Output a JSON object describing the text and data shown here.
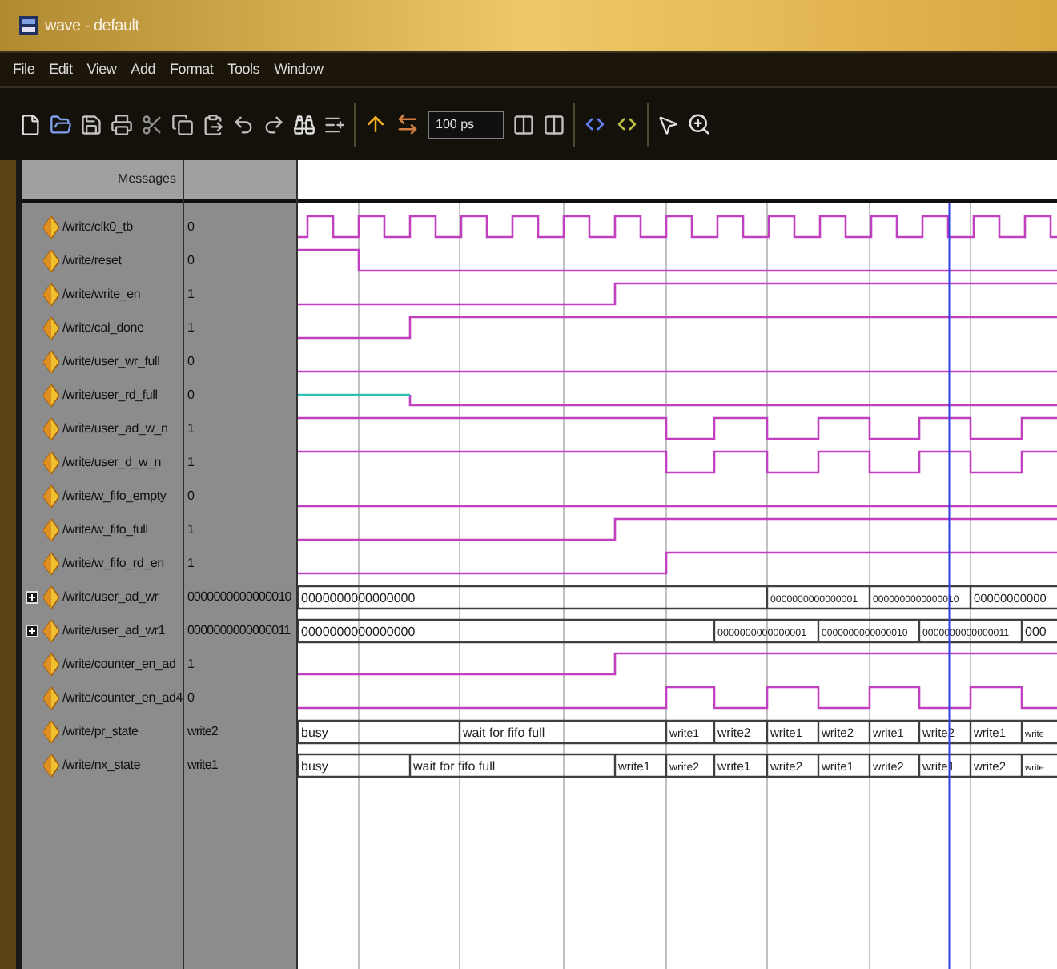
{
  "window": {
    "title": "wave - default"
  },
  "menu": [
    "File",
    "Edit",
    "View",
    "Add",
    "Format",
    "Tools",
    "Window"
  ],
  "toolbar": {
    "time_field": "100 ps"
  },
  "panel": {
    "header": "Messages"
  },
  "signals": [
    {
      "name": "/write/clk0_tb",
      "value": "0",
      "kind": "bit"
    },
    {
      "name": "/write/reset",
      "value": "0",
      "kind": "bit"
    },
    {
      "name": "/write/write_en",
      "value": "1",
      "kind": "bit"
    },
    {
      "name": "/write/cal_done",
      "value": "1",
      "kind": "bit"
    },
    {
      "name": "/write/user_wr_full",
      "value": "0",
      "kind": "bit"
    },
    {
      "name": "/write/user_rd_full",
      "value": "0",
      "kind": "bit"
    },
    {
      "name": "/write/user_ad_w_n",
      "value": "1",
      "kind": "bit"
    },
    {
      "name": "/write/user_d_w_n",
      "value": "1",
      "kind": "bit"
    },
    {
      "name": "/write/w_fifo_empty",
      "value": "0",
      "kind": "bit"
    },
    {
      "name": "/write/w_fifo_full",
      "value": "1",
      "kind": "bit"
    },
    {
      "name": "/write/w_fifo_rd_en",
      "value": "1",
      "kind": "bit"
    },
    {
      "name": "/write/user_ad_wr",
      "value": "0000000000000010",
      "kind": "bus",
      "expanded": false,
      "segments": [
        "0000000000000000",
        "0000000000000001",
        "0000000000000010",
        "00000000000"
      ]
    },
    {
      "name": "/write/user_ad_wr1",
      "value": "0000000000000011",
      "kind": "bus",
      "expanded": false,
      "segments": [
        "0000000000000000",
        "0000000000000001",
        "0000000000000010",
        "0000000000000011",
        "000"
      ]
    },
    {
      "name": "/write/counter_en_ad",
      "value": "1",
      "kind": "bit"
    },
    {
      "name": "/write/counter_en_ad4",
      "value": "0",
      "kind": "bit"
    },
    {
      "name": "/write/pr_state",
      "value": "write2",
      "kind": "bus",
      "segments": [
        "busy",
        "wait for fifo full",
        "write1",
        "write2",
        "write1",
        "write2",
        "write1",
        "write2",
        "write1",
        "write"
      ]
    },
    {
      "name": "/write/nx_state",
      "value": "write1",
      "kind": "bus",
      "segments": [
        "busy",
        "wait for fifo full",
        "write1",
        "write2",
        "write1",
        "write2",
        "write1",
        "write2",
        "write1",
        "write2",
        "write"
      ]
    }
  ]
}
